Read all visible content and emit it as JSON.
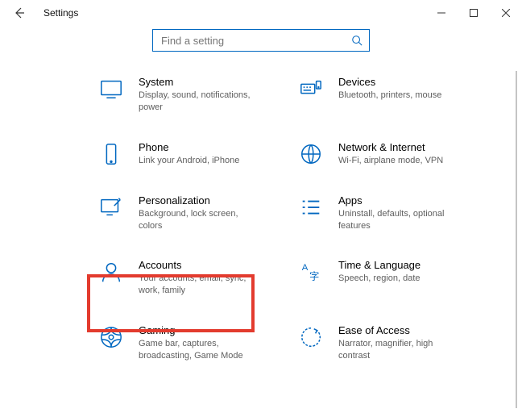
{
  "window": {
    "title": "Settings"
  },
  "search": {
    "placeholder": "Find a setting"
  },
  "tiles": {
    "system": {
      "title": "System",
      "desc": "Display, sound, notifications, power"
    },
    "devices": {
      "title": "Devices",
      "desc": "Bluetooth, printers, mouse"
    },
    "phone": {
      "title": "Phone",
      "desc": "Link your Android, iPhone"
    },
    "network": {
      "title": "Network & Internet",
      "desc": "Wi-Fi, airplane mode, VPN"
    },
    "personalization": {
      "title": "Personalization",
      "desc": "Background, lock screen, colors"
    },
    "apps": {
      "title": "Apps",
      "desc": "Uninstall, defaults, optional features"
    },
    "accounts": {
      "title": "Accounts",
      "desc": "Your accounts, email, sync, work, family"
    },
    "time": {
      "title": "Time & Language",
      "desc": "Speech, region, date"
    },
    "gaming": {
      "title": "Gaming",
      "desc": "Game bar, captures, broadcasting, Game Mode"
    },
    "ease": {
      "title": "Ease of Access",
      "desc": "Narrator, magnifier, high contrast"
    }
  }
}
